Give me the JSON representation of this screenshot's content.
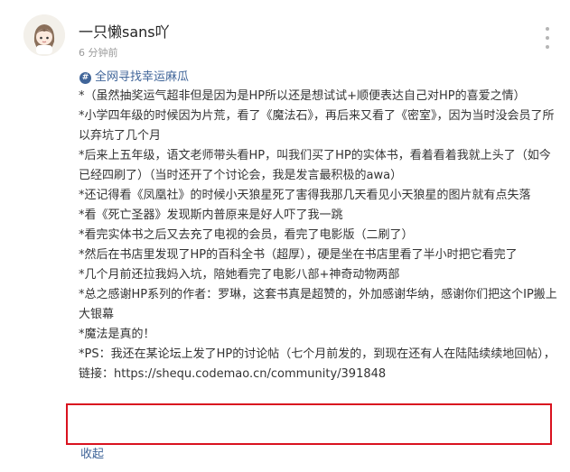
{
  "post": {
    "username": "一只懒sans吖",
    "time": "6 分钟前",
    "topic": "全网寻找幸运麻瓜",
    "paragraphs": [
      "*（虽然抽奖运气超非但是因为是HP所以还是想试试+顺便表达自己对HP的喜爱之情）",
      "*小学四年级的时候因为片荒，看了《魔法石》，再后来又看了《密室》，因为当时没会员了所以弃坑了几个月",
      "*后来上五年级，语文老师带头看HP，叫我们买了HP的实体书，看着看着我就上头了（如今已经四刷了）（当时还开了个讨论会，我是发言最积极的awa）",
      "*还记得看《凤凰社》的时候小天狼星死了害得我那几天看见小天狼星的图片就有点失落",
      "*看《死亡圣器》发现斯内普原来是好人吓了我一跳",
      "*看完实体书之后又去充了电视的会员，看完了电影版（二刷了）",
      "*然后在书店里发现了HP的百科全书（超厚），硬是坐在书店里看了半小时把它看完了",
      "*几个月前还拉我妈入坑，陪她看完了电影八部+神奇动物两部",
      "*总之感谢HP系列的作者：罗琳，这套书真是超赞的，外加感谢华纳，感谢你们把这个IP搬上大银幕",
      "*魔法是真的！",
      "*PS：我还在某论坛上发了HP的讨论帖（七个月前发的，到现在还有人在陆陆续续地回帖），链接：https://shequ.codemao.cn/community/391848"
    ],
    "collapse_label": "收起"
  },
  "colors": {
    "link": "#406599",
    "highlight_border": "#d9121f",
    "text": "#333333",
    "muted": "#9a9a9a"
  },
  "icons": {
    "topic": "hash-icon",
    "menu": "more-vertical-icon"
  }
}
